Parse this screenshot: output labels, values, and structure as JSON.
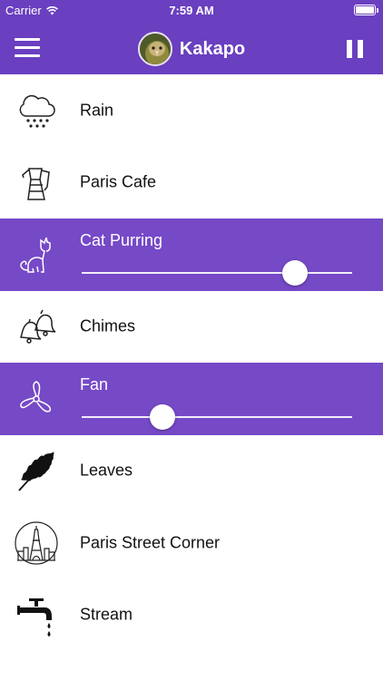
{
  "status_bar": {
    "carrier": "Carrier",
    "time": "7:59 AM",
    "icons": [
      "wifi-icon",
      "battery-icon"
    ]
  },
  "nav": {
    "title": "Kakapo",
    "menu_icon": "hamburger-menu-icon",
    "action_icon": "pause-icon",
    "avatar": "kakapo-avatar"
  },
  "colors": {
    "accent": "#6a3fc0",
    "active_row": "#7649c7",
    "text": "#111111",
    "white": "#ffffff"
  },
  "sounds": [
    {
      "label": "Rain",
      "icon": "rain-cloud-icon",
      "active": false
    },
    {
      "label": "Paris Cafe",
      "icon": "coffee-pot-icon",
      "active": false
    },
    {
      "label": "Cat Purring",
      "icon": "cat-icon",
      "active": true,
      "volume": 0.79
    },
    {
      "label": "Chimes",
      "icon": "bells-icon",
      "active": false
    },
    {
      "label": "Fan",
      "icon": "fan-icon",
      "active": true,
      "volume": 0.3
    },
    {
      "label": "Leaves",
      "icon": "leaf-icon",
      "active": false
    },
    {
      "label": "Paris Street Corner",
      "icon": "eiffel-tower-icon",
      "active": false
    },
    {
      "label": "Stream",
      "icon": "faucet-icon",
      "active": false
    }
  ]
}
